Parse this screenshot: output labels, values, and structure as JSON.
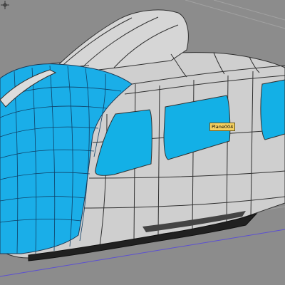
{
  "viewport": {
    "background": "#8c8c8c",
    "selected_object_label": "Plane004",
    "pivot_icon": "move-gizmo-icon"
  },
  "model": {
    "body_color": "#cfcfcf",
    "edge_color": "#303030",
    "window_color": "#13b0e6",
    "front_color": "#1aaee8",
    "underside_color": "#202020",
    "ground_line_color": "#5b4fd2",
    "grid_line_color": "#a2a2a2"
  }
}
